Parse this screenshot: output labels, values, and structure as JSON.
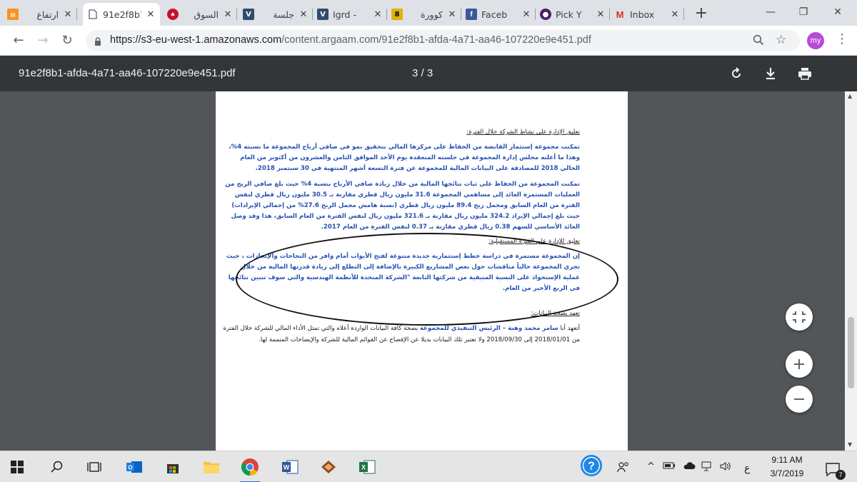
{
  "browser": {
    "tabs": [
      {
        "label": "ارتفاع",
        "icon": "argaam-icon",
        "active": false
      },
      {
        "label": "91e2f8b1",
        "icon": "document-icon",
        "active": true
      },
      {
        "label": "السوق",
        "icon": "pokerstars-icon",
        "active": false
      },
      {
        "label": "جلسة",
        "icon": "argaam-blue-icon",
        "active": false
      },
      {
        "label": "Igrd -",
        "icon": "argaam-blue-icon",
        "active": false
      },
      {
        "label": "كوورة",
        "icon": "kooora-icon",
        "active": false
      },
      {
        "label": "Faceb",
        "icon": "facebook-icon",
        "active": false
      },
      {
        "label": "Pick Y",
        "icon": "pick-icon",
        "active": false
      },
      {
        "label": "Inbox",
        "icon": "gmail-icon",
        "active": false
      }
    ],
    "url_host": "https://s3-eu-west-1.amazonaws.com",
    "url_path": "/content.argaam.com/91e2f8b1-afda-4a71-aa46-107220e9e451.pdf",
    "profile_initials": "my"
  },
  "pdf": {
    "filename": "91e2f8b1-afda-4a71-aa46-107220e9e451.pdf",
    "page_indicator": "3 / 3"
  },
  "document": {
    "heading1": "تعليق الإدارة على نشاط الشركة خلال الفترة:",
    "para1": "تمكنت مجموعة إستثمار القابضة من الحفاظ على مركزها المالي بتحقيق نمو في صافي أرباح المجموعة ما نسبته 4%، وهذا ما أعلنه مجلس إدارة المجموعة في جلسته المنعقدة يوم الأحد الموافق الثامن والعشرون من أكتوبر من العام الحالي 2018 للمصادقة على البيانات المالية للمجموعة عن فترة التسعة أشهر المنتهية في 30 سبتمبر 2018.",
    "para2": "تمكنت المجموعة من الحفاظ على ثبات نتائجها المالية من خلال زيادة صافي الأرباح بنسبة 4% حيث بلغ صافي الربح من العمليات المستمرة العائد إلى مساهمي المجموعة 31.6 مليون ريال قطري مقارنة بـ 30.5 مليون ريال قطري لنفس الفترة من العام السابق ومجمل ربح 89.4 مليون ريال قطري (نسبة هامش مجمل الربح 27.6% من إجمالي الإيرادات) حيث بلغ إجمالي الإيراد 324.2 مليون ريال مقارنة بـ 321.6 مليون ريال لنفس الفترة من العام السابق، هذا وقد وصل العائد الأساسي للسهم 0.38 ريال قطري مقارنة بـ 0.37 لنفس الفترة من العام 2017.",
    "heading2": "تعليق للإدارة على الفترة المستقبلية:",
    "para3": "إن المجموعة مستمرة في دراسة خطط إستثمارية جديدة متنوعة لفتح الأبواب أمام وافر من النجاحات والإنجازات ، حيث تجري المجموعة حالياً مناقشات حول بعض المشاريع الكبيرة بالإضافة إلى التطلع إلى زيادة قدرتها المالية من خلال عملية الإستحواذ على النسبة المتبقية من شركتها التابعة \"الشركة المتحدة للأنظمة الهندسية والتي سوف تتبين نتائجها في الربع الأخير من العام.",
    "heading3": "تعهد بصحة البيانات:",
    "para4_prefix": "أتعهد أنا ",
    "para4_name": "سامر محمد وهبة – الرئيس التنفيذي للمجموعة",
    "para4_suffix": " بصحة كافة البيانات الواردة أعلاه والتي تمثل الأداء المالي للشركة خلال الفترة من 2018/01/01 إلى 2018/09/30 ولا تعتبر تلك البيانات بديلا عن الإفصاح عن القوائم المالية للشركة والإيضاحات المتممة لها."
  },
  "taskbar": {
    "time": "9:11 AM",
    "date": "3/7/2019",
    "language": "ع",
    "notification_count": "7"
  }
}
